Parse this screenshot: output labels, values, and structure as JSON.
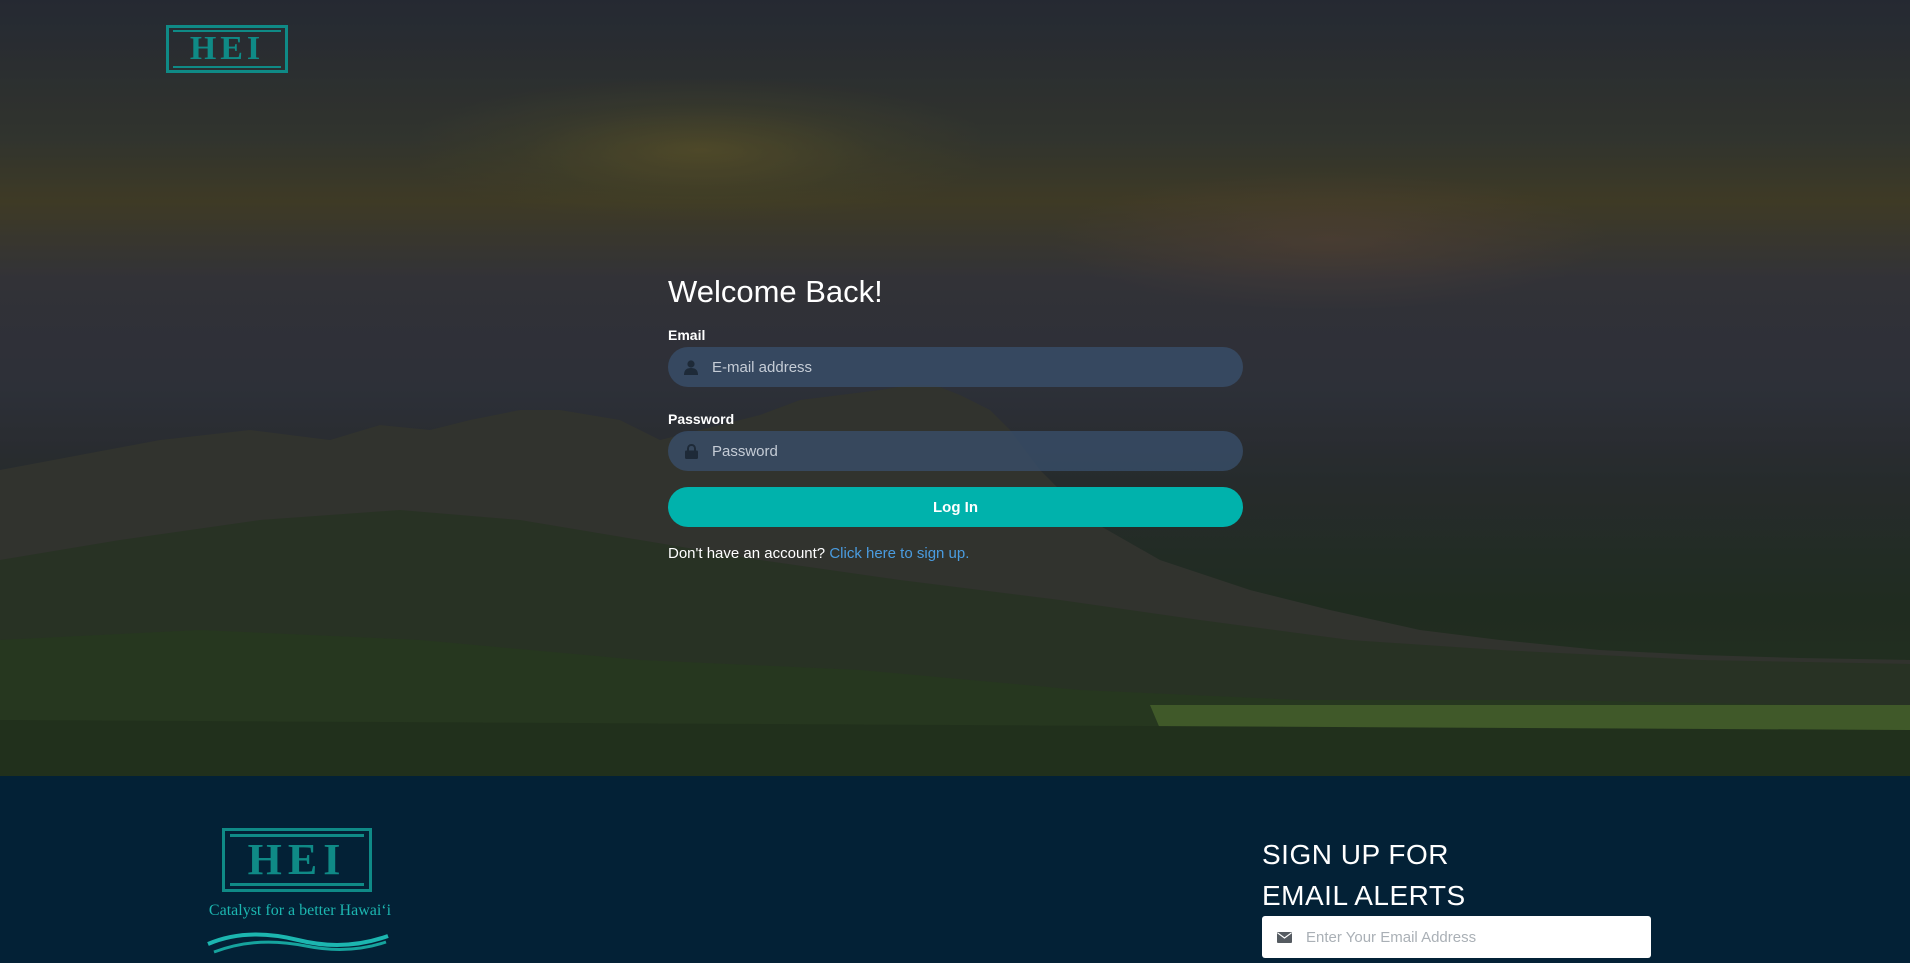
{
  "brand": {
    "logo_text": "HEI",
    "tagline": "Catalyst for a better Hawai‘i"
  },
  "login": {
    "title": "Welcome Back!",
    "email_label": "Email",
    "email_placeholder": "E-mail address",
    "password_label": "Password",
    "password_placeholder": "Password",
    "submit_label": "Log In",
    "signup_prompt": "Don't have an account?",
    "signup_link": "Click here to sign up."
  },
  "footer": {
    "alerts_title_line1": "SIGN UP FOR",
    "alerts_title_line2": "EMAIL ALERTS",
    "alerts_placeholder": "Enter Your Email Address"
  },
  "colors": {
    "accent": "#00b2ac",
    "link": "#4a9ce0",
    "footer_bg": "#032136",
    "logo": "#0f8a86"
  },
  "icons": {
    "email_field": "user-icon",
    "password_field": "lock-icon",
    "alerts_field": "envelope-icon"
  }
}
